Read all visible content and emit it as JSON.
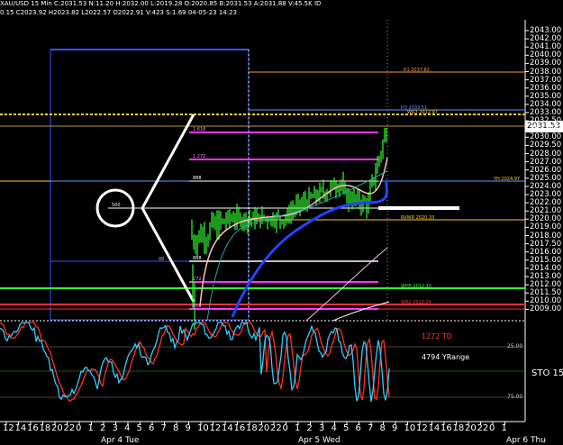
{
  "header": {
    "line1": "XAU/USD 15 Min  C:2031.53  N:11.20  H:2032.00  L:2019.28  O:2020.85  B:2031.53  A:2031.88  V:45.5K  ID",
    "line2": "0.15  C2023.92  H2023.82  L2022.57  O2022.91  V:423  S:1.69  04-05-23  14:23"
  },
  "price_axis": {
    "labels": [
      "2043.00",
      "2042.00",
      "2041.00",
      "2040.00",
      "2039.00",
      "2038.00",
      "2037.00",
      "2036.00",
      "2035.00",
      "2034.00",
      "2033.00",
      "2032.50",
      "2031.00",
      "2030.00",
      "2029.50",
      "2028.00",
      "2027.00",
      "2026.00",
      "2025.00",
      "2024.00",
      "2023.00",
      "2022.00",
      "2021.00",
      "2020.00",
      "2019.00",
      "2018.00",
      "2017.50",
      "2016.00",
      "2015.00",
      "2014.00",
      "2013.00",
      "2012.00",
      "2011.50",
      "2010.00",
      "2009.00"
    ],
    "last_price": "2031.53"
  },
  "levels": [
    {
      "label": "R1  2037.82",
      "color": "#ff9933"
    },
    {
      "label": "H3  2033.51",
      "color": "#6699ff"
    },
    {
      "label": "WR3  2032.97",
      "color": "#ffcc33"
    },
    {
      "label": "YH  2024.97",
      "color": "#ffcc33"
    },
    {
      "label": "RVWR  2020.33",
      "color": "#ffcc33"
    },
    {
      "label": "WH5  2012.15",
      "color": "#33ff33"
    },
    {
      "label": "WR2  2010.24",
      "color": "#ff3333"
    }
  ],
  "fib_labels": [
    "1.618",
    "1.272",
    "888",
    "500",
    "888",
    "88",
    "272",
    "818"
  ],
  "oscillator": {
    "td_text": "1272 TD",
    "range_text": "4794 YRange",
    "indicator_label": "STO  15",
    "axis": [
      "25.00",
      "75.00"
    ]
  },
  "time_axis": {
    "labels": [
      "12",
      "14",
      "16",
      "18",
      "20",
      "22",
      "0",
      "1",
      "2",
      "3",
      "4",
      "5",
      "6",
      "7",
      "8",
      "9",
      "10",
      "12",
      "14",
      "16",
      "18",
      "20",
      "22",
      "0",
      "1",
      "2",
      "3",
      "4",
      "5",
      "6",
      "7",
      "8",
      "9",
      "10",
      "12",
      "14",
      "16",
      "18",
      "20",
      "22",
      "0",
      "1"
    ],
    "dates": [
      "Apr 4 Tue",
      "Apr 5 Wed",
      "Apr 6 Thu"
    ]
  }
}
